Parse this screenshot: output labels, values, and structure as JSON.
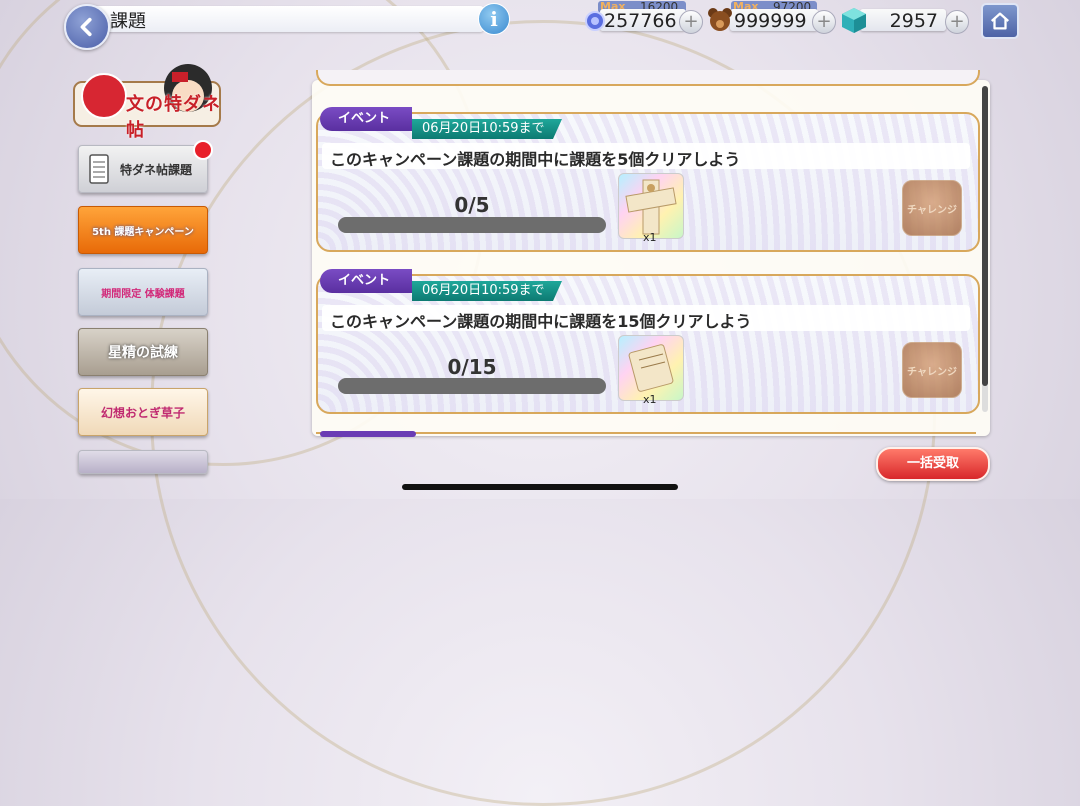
{
  "header": {
    "title": "課題",
    "back_icon": "back-arrow-icon",
    "info_label": "i",
    "home_icon": "home-icon"
  },
  "resources": [
    {
      "name": "jewel",
      "icon": "blue-orb-icon",
      "max_label": "Max",
      "max_value": "16200",
      "value": "257766"
    },
    {
      "name": "stamina",
      "icon": "bear-icon",
      "max_label": "Max",
      "max_value": "97200",
      "value": "999999"
    },
    {
      "name": "gem",
      "icon": "green-cube-icon",
      "value": "2957"
    }
  ],
  "plus_label": "+",
  "sidebar": {
    "logo_text": "文の特ダネ帖",
    "items": [
      {
        "label": "特ダネ帖課題",
        "has_badge": true
      },
      {
        "label": "5th 課題キャンペーン"
      },
      {
        "label": "期間限定 体験課題"
      },
      {
        "label": "星精の試練"
      },
      {
        "label": "幻想おとぎ草子"
      }
    ]
  },
  "missions": [
    {
      "tag": "イベント",
      "deadline": "06月20日10:59まで",
      "description": "このキャンペーン課題の期間中に課題を5個クリアしよう",
      "progress_text": "0/5",
      "progress": 0,
      "reward_icon": "ticket-cross-icon",
      "reward_qty": "x1",
      "button": "チャレンジ"
    },
    {
      "tag": "イベント",
      "deadline": "06月20日10:59まで",
      "description": "このキャンペーン課題の期間中に課題を15個クリアしよう",
      "progress_text": "0/15",
      "progress": 0,
      "reward_icon": "ticket-scroll-icon",
      "reward_qty": "x1",
      "button": "チャレンジ"
    }
  ],
  "footer": {
    "bulk_receive": "一括受取"
  },
  "colors": {
    "event_tag": "#6a3cb4",
    "deadline": "#14958a",
    "card_border": "#d8a85c",
    "bulk_button": "#e23a35"
  }
}
